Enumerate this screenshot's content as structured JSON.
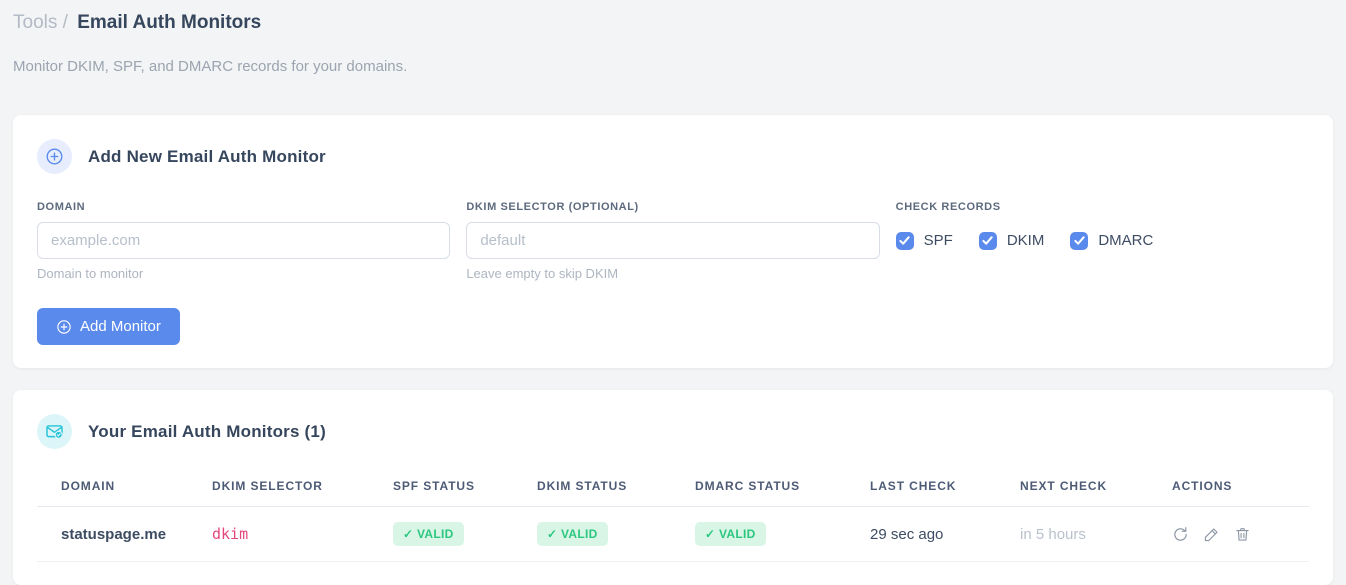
{
  "page": {
    "breadcrumb": {
      "section": "Tools",
      "separator": "/",
      "current": "Email Auth Monitors"
    },
    "subtitle": "Monitor DKIM, SPF, and DMARC records for your domains."
  },
  "add_card": {
    "icon": "plus-circle-icon",
    "title": "Add New Email Auth Monitor",
    "fields": {
      "domain": {
        "label": "DOMAIN",
        "placeholder": "example.com",
        "value": "",
        "helper": "Domain to monitor"
      },
      "dkim_selector": {
        "label": "DKIM SELECTOR (OPTIONAL)",
        "placeholder": "default",
        "value": "",
        "helper": "Leave empty to skip DKIM"
      }
    },
    "check_records": {
      "label": "CHECK RECORDS",
      "options": [
        {
          "label": "SPF",
          "checked": true
        },
        {
          "label": "DKIM",
          "checked": true
        },
        {
          "label": "DMARC",
          "checked": true
        }
      ]
    },
    "submit_label": "Add Monitor"
  },
  "monitors_card": {
    "icon": "email-check-icon",
    "title": "Your Email Auth Monitors (1)",
    "table": {
      "columns": [
        "DOMAIN",
        "DKIM SELECTOR",
        "SPF STATUS",
        "DKIM STATUS",
        "DMARC STATUS",
        "LAST CHECK",
        "NEXT CHECK",
        "ACTIONS"
      ],
      "rows": [
        {
          "domain": "statuspage.me",
          "dkim_selector": "dkim",
          "spf_status": "✓ VALID",
          "dkim_status": "✓ VALID",
          "dmarc_status": "✓ VALID",
          "last_check": "29 sec ago",
          "next_check": "in 5 hours",
          "actions": [
            "refresh-icon",
            "edit-icon",
            "delete-icon"
          ]
        }
      ]
    }
  },
  "colors": {
    "accent_blue": "#5a8aec",
    "success_green": "#2bc77f",
    "success_bg": "#d8f5e6",
    "cyan_accent": "#22c3d6",
    "selector_pink": "#e5477a",
    "page_bg": "#f3f4f5"
  }
}
